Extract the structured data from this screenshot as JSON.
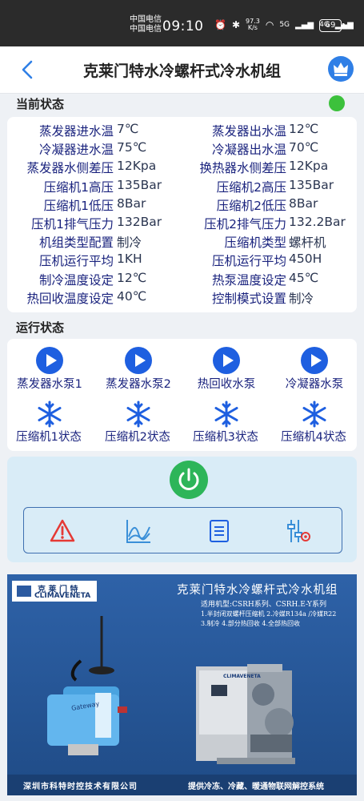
{
  "statusbar": {
    "carrier1": "中国电信",
    "carrier2": "中国电信",
    "time": "09:10",
    "speed_value": "97.3",
    "speed_unit": "K/s",
    "signal1": "5G",
    "signal2": "4G",
    "battery": "69"
  },
  "header": {
    "title": "克莱门特水冷螺杆式冷水机组"
  },
  "current_status": {
    "title": "当前状态",
    "indicator_color": "#3cc13c",
    "rows": [
      {
        "l1": "蒸发器进水温",
        "v1": "7℃",
        "l2": "蒸发器出水温",
        "v2": "12℃"
      },
      {
        "l1": "冷凝器进水温",
        "v1": "75℃",
        "l2": "冷凝器出水温",
        "v2": "70℃"
      },
      {
        "l1": "蒸发器水侧差压",
        "v1": "12Kpa",
        "l2": "换热器水侧差压",
        "v2": "12Kpa"
      },
      {
        "l1": "压缩机1高压",
        "v1": "135Bar",
        "l2": "压缩机2高压",
        "v2": "135Bar"
      },
      {
        "l1": "压缩机1低压",
        "v1": "8Bar",
        "l2": "压缩机2低压",
        "v2": "8Bar"
      },
      {
        "l1": "压机1排气压力",
        "v1": "132Bar",
        "l2": "压机2排气压力",
        "v2": "132.2Bar"
      },
      {
        "l1": "机组类型配置",
        "v1": "制冷",
        "l2": "压缩机类型",
        "v2": "螺杆机"
      },
      {
        "l1": "压机运行平均",
        "v1": "1KH",
        "l2": "压机运行平均",
        "v2": "450H"
      },
      {
        "l1": "制冷温度设定",
        "v1": "12℃",
        "l2": "热泵温度设定",
        "v2": "45℃"
      },
      {
        "l1": "热回收温度设定",
        "v1": "40℃",
        "l2": "控制模式设置",
        "v2": "制冷"
      }
    ]
  },
  "run_status": {
    "title": "运行状态",
    "pumps": [
      "蒸发器水泵1",
      "蒸发器水泵2",
      "热回收水泵",
      "冷凝器水泵"
    ],
    "compressors": [
      "压缩机1状态",
      "压缩机2状态",
      "压缩机3状态",
      "压缩机4状态"
    ]
  },
  "colors": {
    "accent": "#1e5fe0",
    "label": "#1a237e",
    "power": "#2db559",
    "alarm": "#e53935"
  },
  "banner": {
    "brand_cn": "克 莱 门 特",
    "brand_en": "CLIMAVENETA",
    "title": "克莱门特水冷螺杆式冷水机组",
    "line1": "适用机型:CSRH系列、CSRH.E-Y系列",
    "line2": "1.半封闭双螺杆压缩机 2.冷媒R134a /冷媒R22",
    "line3": "3.制冷 4.部分热回收 4.全部热回收",
    "gateway_label": "Gateway",
    "unit_label": "CLIMAVENETA",
    "company": "深圳市科特时控技术有限公司",
    "slogan": "提供冷冻、冷藏、暖通物联网解控系统"
  }
}
